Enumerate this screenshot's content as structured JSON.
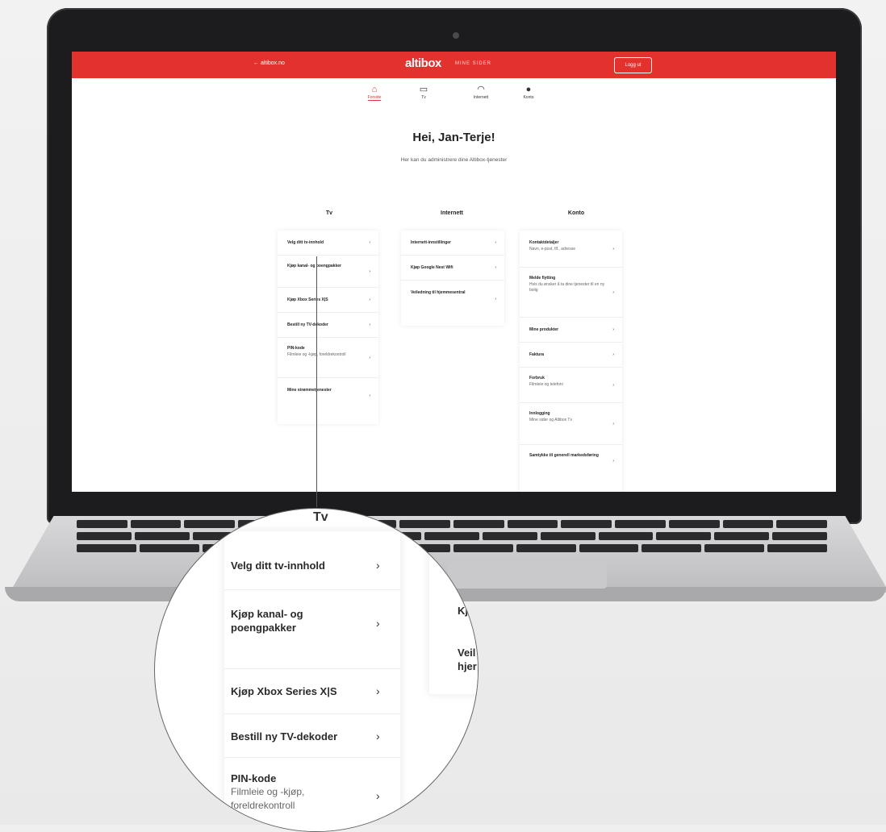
{
  "header": {
    "back_link": "← altibox.no",
    "logo": "altibox",
    "logo_sub": "MINE SIDER",
    "login_label": "Logg ut"
  },
  "nav": [
    {
      "label": "Forside",
      "icon": "home-icon",
      "active": true
    },
    {
      "label": "Tv",
      "icon": "tv-icon",
      "active": false
    },
    {
      "label": "Internett",
      "icon": "wifi-icon",
      "active": false
    },
    {
      "label": "Konto",
      "icon": "user-icon",
      "active": false
    }
  ],
  "greeting": "Hei, Jan-Terje!",
  "subgreeting": "Her kan du administrere dine Altibox-tjenester",
  "columns": {
    "tv": {
      "heading": "Tv",
      "items": [
        {
          "label": "Velg ditt tv-innhold",
          "sub": ""
        },
        {
          "label": "Kjøp kanal- og poengpakker",
          "sub": ""
        },
        {
          "label": "Kjøp Xbox Series X|S",
          "sub": ""
        },
        {
          "label": "Bestill ny TV-dekoder",
          "sub": ""
        },
        {
          "label": "PIN-kode",
          "sub": "Filmleie og -kjøp, foreldrekontroll"
        },
        {
          "label": "Mine strømmetjenester",
          "sub": ""
        }
      ]
    },
    "internett": {
      "heading": "Internett",
      "items": [
        {
          "label": "Internett-innstillinger",
          "sub": ""
        },
        {
          "label": "Kjøp Google Nest Wifi",
          "sub": ""
        },
        {
          "label": "Veiledning til hjemmesentral",
          "sub": ""
        }
      ]
    },
    "konto": {
      "heading": "Konto",
      "items": [
        {
          "label": "Kontaktdetaljer",
          "sub": "Navn, e-post, tlf., adresse"
        },
        {
          "label": "Melde flytting",
          "sub": "Hvis du ønsker å ta dine tjenester til en ny bolig"
        },
        {
          "label": "Mine produkter",
          "sub": ""
        },
        {
          "label": "Faktura",
          "sub": ""
        },
        {
          "label": "Forbruk",
          "sub": "Filmleie og telefoni"
        },
        {
          "label": "Innlogging",
          "sub": "Mine sider og Altibox Tv"
        },
        {
          "label": "Samtykke til generell markedsføring",
          "sub": ""
        }
      ]
    }
  },
  "magnifier": {
    "title": "Tv",
    "items": [
      {
        "label": "Velg ditt tv-innhold",
        "sub": ""
      },
      {
        "label": "Kjøp kanal- og poengpakker",
        "sub": ""
      },
      {
        "label": "Kjøp Xbox Series X|S",
        "sub": ""
      },
      {
        "label": "Bestill ny TV-dekoder",
        "sub": ""
      },
      {
        "label": "PIN-kode",
        "sub": "Filmleie og -kjøp, foreldrekontroll"
      }
    ],
    "peek": [
      "Kj",
      "Veil hjer"
    ]
  },
  "chevron": "›",
  "colors": {
    "brand": "#e3312d",
    "text": "#222222",
    "muted": "#666666"
  }
}
